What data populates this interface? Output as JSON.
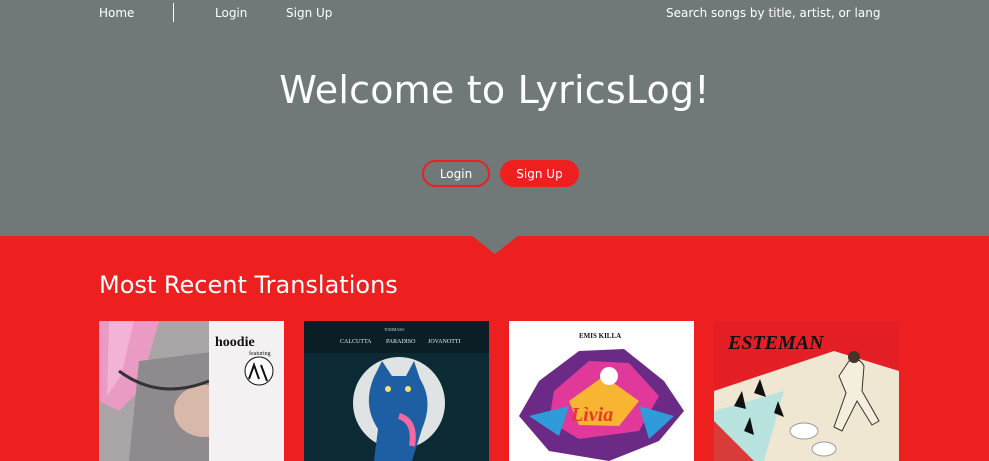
{
  "nav": {
    "home_label": "Home",
    "login_label": "Login",
    "signup_label": "Sign Up",
    "search_placeholder": "Search songs by title, artist, or language"
  },
  "hero": {
    "title": "Welcome to LyricsLog!",
    "login_button": "Login",
    "signup_button": "Sign Up"
  },
  "recent": {
    "title": "Most Recent Translations",
    "cards": [
      {
        "art_text": "hoodie",
        "art_subtext": "featuring"
      },
      {
        "art_text_1": "CALCUTTA",
        "art_text_2": "PARADISO",
        "art_text_3": "JOVANOTTI",
        "art_small": "TOMMASO"
      },
      {
        "art_text": "EMIS KILLA"
      },
      {
        "art_text": "ESTEMAN"
      }
    ]
  },
  "colors": {
    "hero_bg": "#707978",
    "accent_red": "#ee1f1f",
    "text": "#ffffff"
  }
}
